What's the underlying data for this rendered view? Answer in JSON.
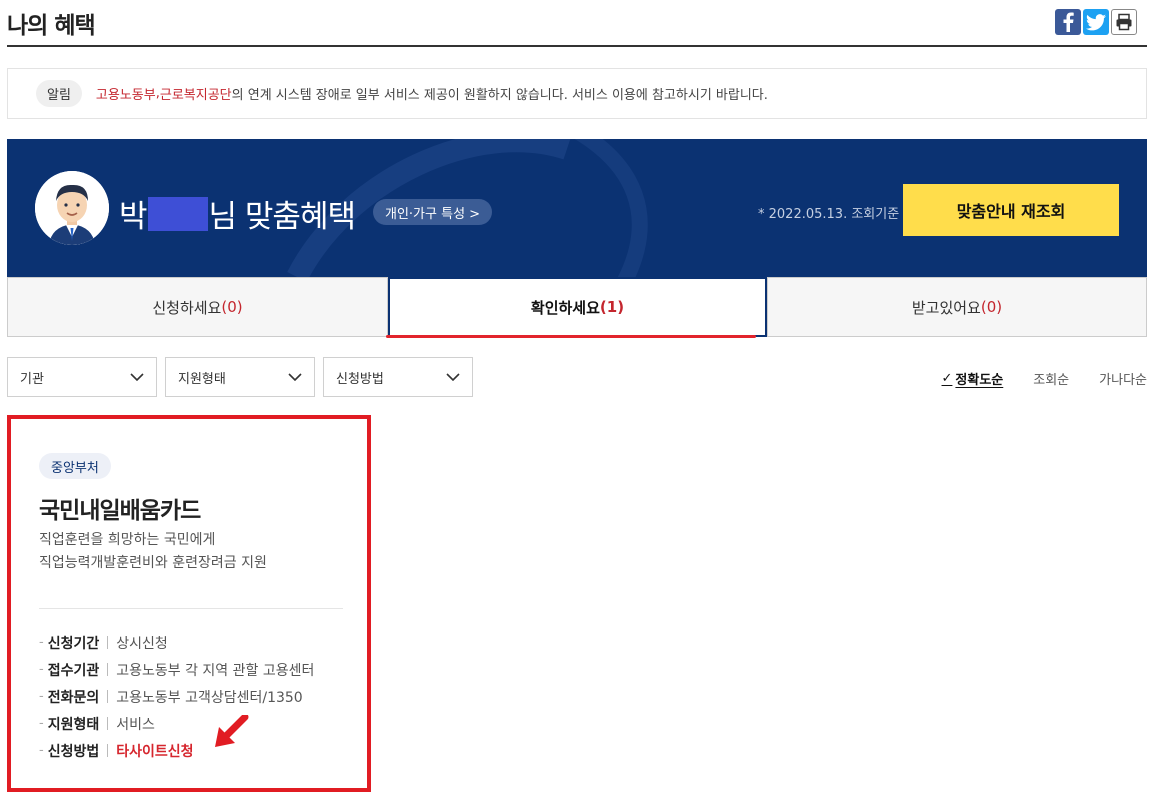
{
  "page": {
    "title": "나의 혜택"
  },
  "share": {
    "facebook": "facebook-icon",
    "twitter": "twitter-icon",
    "print": "print-icon"
  },
  "notice": {
    "badge": "알림",
    "org1": "고용노동부",
    "comma": ", ",
    "org2": "근로복지공단",
    "message": "의 연계 시스템 장애로 일부 서비스 제공이 원활하지 않습니다. 서비스 이용에 참고하시기 바랍니다."
  },
  "hero": {
    "surname": "박",
    "suffix": "님 맞춤혜택",
    "trait_button": "개인·가구 특성 >",
    "date_note": "* 2022.05.13. 조회기준",
    "recheck_button": "맞춤안내 재조회"
  },
  "tabs": [
    {
      "label": "신청하세요",
      "count": "(0)"
    },
    {
      "label": "확인하세요",
      "count": "(1)"
    },
    {
      "label": "받고있어요",
      "count": "(0)"
    }
  ],
  "filters": [
    {
      "label": "기관"
    },
    {
      "label": "지원형태"
    },
    {
      "label": "신청방법"
    }
  ],
  "sort": {
    "check": "✓",
    "accuracy": "정확도순",
    "views": "조회순",
    "alpha": "가나다순"
  },
  "card": {
    "category": "중앙부처",
    "name": "국민내일배움카드",
    "desc_line1": "직업훈련을 희망하는 국민에게",
    "desc_line2": "직업능력개발훈련비와 훈련장려금 지원",
    "rows": [
      {
        "key": "신청기간",
        "value": "상시신청"
      },
      {
        "key": "접수기관",
        "value": "고용노동부 각 지역 관할 고용센터"
      },
      {
        "key": "전화문의",
        "value": "고용노동부 고객상담센터/1350"
      },
      {
        "key": "지원형태",
        "value": "서비스"
      },
      {
        "key": "신청방법",
        "value": "타사이트신청"
      }
    ]
  },
  "colors": {
    "navy": "#0b3272",
    "yellow": "#ffdd4b",
    "red": "#e11c23"
  }
}
